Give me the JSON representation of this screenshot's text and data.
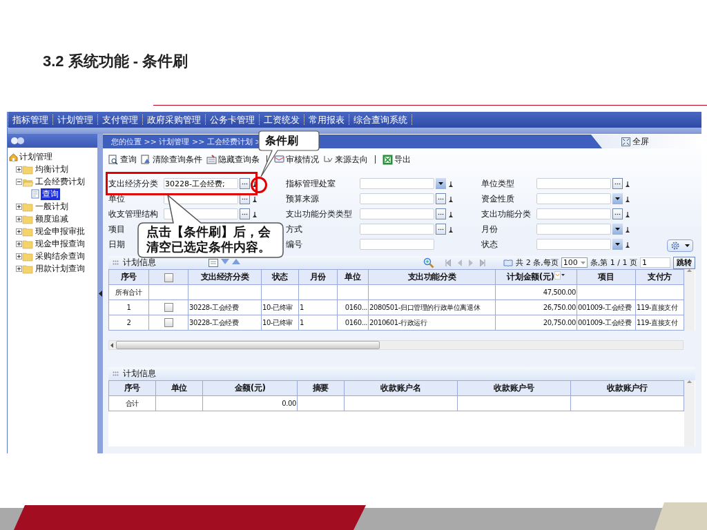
{
  "slide": {
    "title": "3.2 系统功能 - 条件刷"
  },
  "app": {
    "menu": [
      "指标管理",
      "计划管理",
      "支付管理",
      "政府采购管理",
      "公务卡管理",
      "工资统发",
      "常用报表",
      "综合查询系统"
    ],
    "sidebar": {
      "tree": [
        {
          "label": "计划管理",
          "children": [
            {
              "label": "均衡计划",
              "expanded": false
            },
            {
              "label": "工会经费计划",
              "expanded": true,
              "children": [
                {
                  "label": "查询",
                  "selected": true
                }
              ]
            },
            {
              "label": "一般计划",
              "expanded": false
            },
            {
              "label": "额度追减",
              "expanded": false
            },
            {
              "label": "现金申报审批",
              "expanded": false
            },
            {
              "label": "现金申报查询",
              "expanded": false
            },
            {
              "label": "采购结余查询",
              "expanded": false
            },
            {
              "label": "用款计划查询",
              "expanded": false
            }
          ]
        }
      ]
    },
    "breadcrumb": "您的位置 >> 计划管理 >> 工会经费计划 >",
    "fullscreen": "全屏",
    "toolbar": [
      {
        "kind": "query",
        "label": "查询"
      },
      {
        "kind": "clear",
        "label": "清除查询条件"
      },
      {
        "kind": "hide",
        "label": "隐藏查询条"
      },
      {
        "kind": "separator"
      },
      {
        "kind": "audit",
        "label": "审核情况"
      },
      {
        "kind": "source",
        "label": "来源去向"
      },
      {
        "kind": "separator"
      },
      {
        "kind": "export",
        "label": "导出"
      }
    ],
    "filters": [
      {
        "label": "支出经济分类",
        "kind": "picker",
        "value": "30228-工会经费;"
      },
      {
        "label": "指标管理处室",
        "kind": "dropdown"
      },
      {
        "label": "单位类型",
        "kind": "picker"
      },
      {
        "label": "单位",
        "kind": "picker"
      },
      {
        "label": "预算来源",
        "kind": "picker"
      },
      {
        "label": "资金性质",
        "kind": "dropdown"
      },
      {
        "label": "收支管理结构",
        "kind": "picker"
      },
      {
        "label": "支出功能分类类型",
        "kind": "picker"
      },
      {
        "label": "支出功能分类",
        "kind": "picker"
      },
      {
        "label": "项目",
        "kind": "none"
      },
      {
        "label": "方式",
        "kind": "picker"
      },
      {
        "label": "月份",
        "kind": "dropdown"
      },
      {
        "label": "日期",
        "kind": "none"
      },
      {
        "label": "编号",
        "kind": "text"
      },
      {
        "label": "状态",
        "kind": "dropdown"
      }
    ],
    "plan_table": {
      "title": "计划信息",
      "pager": {
        "total": "共 2 条,每页",
        "page_size": "100",
        "page_of": "条,第 1 / 1 页",
        "page": "1",
        "go": "跳转"
      },
      "all_checked": false,
      "columns": [
        "序号",
        "",
        "支出经济分类",
        "状态",
        "月份",
        "单位",
        "支出功能分类",
        "计划金额(元)",
        "项目",
        "支付方"
      ],
      "rows": [
        {
          "kind": "total",
          "cells": [
            "所有合计",
            "",
            "",
            "",
            "",
            "",
            "",
            "47,500.00",
            "",
            ""
          ]
        },
        {
          "kind": "item",
          "checked": false,
          "cells": [
            "1",
            "",
            "30228-工会经费",
            "10-已终审",
            "1",
            "0160...",
            "2080501-归口管理的行政单位离退休",
            "26,750.00",
            "001009-工会经费",
            "119-直接支付"
          ]
        },
        {
          "kind": "item",
          "checked": false,
          "cells": [
            "2",
            "",
            "30228-工会经费",
            "10-已终审",
            "1",
            "0160...",
            "2010601-行政运行",
            "20,750.00",
            "001009-工会经费",
            "119-直接支付"
          ]
        }
      ]
    },
    "info_table": {
      "title": "计划信息",
      "columns": [
        "序号",
        "单位",
        "金额(元)",
        "摘要",
        "收款账户名",
        "收款账户号",
        "收款账户行"
      ],
      "rows": [
        {
          "cells": [
            "合计",
            "",
            "0.00",
            "",
            "",
            "",
            ""
          ]
        }
      ]
    },
    "callouts": [
      {
        "kind": "label",
        "text": "条件刷"
      },
      {
        "kind": "note",
        "text": "点击【条件刷】后，会清空已选定条件内容。"
      }
    ]
  }
}
